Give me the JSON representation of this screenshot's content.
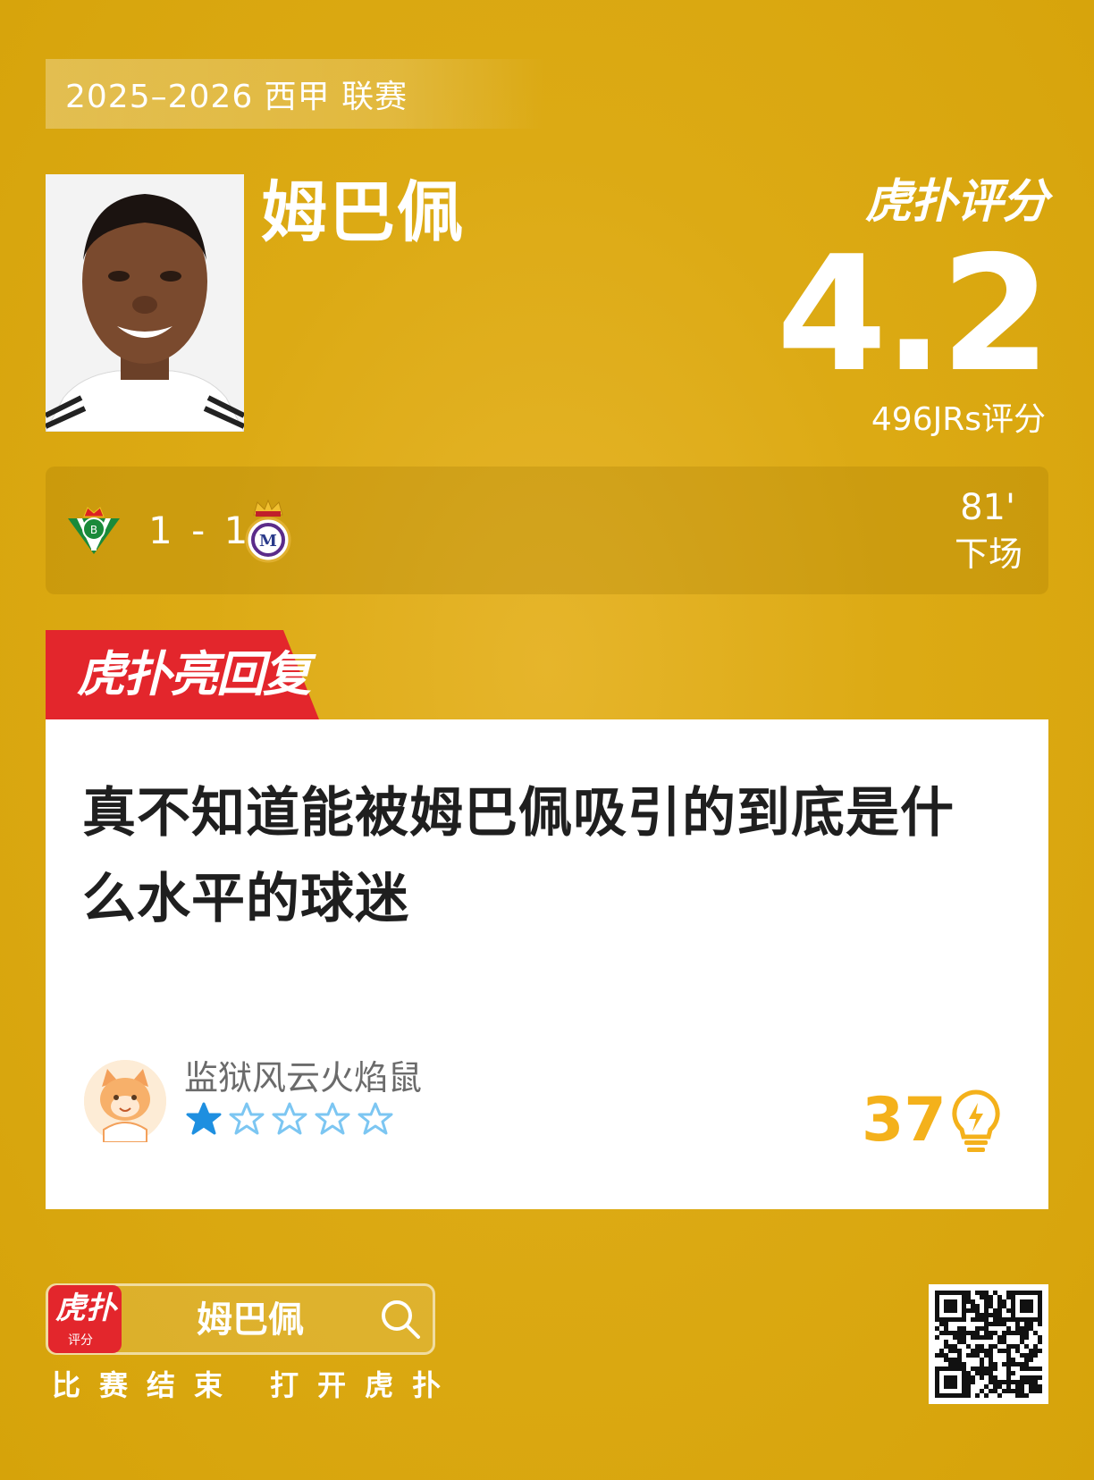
{
  "season": {
    "label": "2025–2026 西甲 联赛"
  },
  "player": {
    "name": "姆巴佩"
  },
  "rating": {
    "brand": "虎扑评分",
    "score": "4.2",
    "votes": "496JRs评分"
  },
  "match": {
    "score": "1 - 1",
    "minute": "81'",
    "status": "下场"
  },
  "reply": {
    "tag": "虎扑亮回复",
    "text": "真不知道能被姆巴佩吸引的到底是什么水平的球迷",
    "user": "监狱风云火焰鼠",
    "star_rating": 1,
    "star_max": 5,
    "likes": "37"
  },
  "footer": {
    "app_icon_label": "虎扑",
    "app_icon_sub": "评分",
    "search_term": "姆巴佩",
    "cta": "比赛结束 打开虎扑"
  },
  "colors": {
    "accent_red": "#e3262c",
    "star_filled": "#1e8fe0",
    "likes": "#f4b11b"
  }
}
